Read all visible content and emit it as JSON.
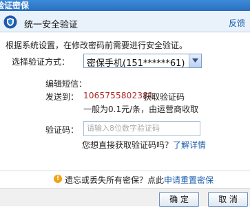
{
  "window": {
    "title": "验证密保"
  },
  "header": {
    "title": "统一安全验证",
    "feedback": "反馈"
  },
  "tip": "根据系统设置，在修改密码前需要进行安全验证。",
  "method": {
    "label": "选择验证方式：",
    "selected": "密保手机(151******61)"
  },
  "sms": {
    "edit_label": "编辑短信：",
    "send_label": "发送到：",
    "number": "1065755802381",
    "action_text": "获取验证码",
    "fee_text": "一般为0.1元/条，由运营商收取"
  },
  "code": {
    "label": "验证码：",
    "placeholder": "请输入8位数字验证码"
  },
  "ask": {
    "prefix": "您想直接获取验证码吗？",
    "link": "了解详情"
  },
  "warning": {
    "prefix": "遗忘或丢失所有密保？点此",
    "link": "申请重置密保"
  },
  "buttons": {
    "ok": "确 定",
    "cancel": "取 消"
  },
  "colors": {
    "accent": "#2a6fc1",
    "link": "#1d5fae",
    "number": "#b02a2a",
    "warn": "#f0a218"
  }
}
